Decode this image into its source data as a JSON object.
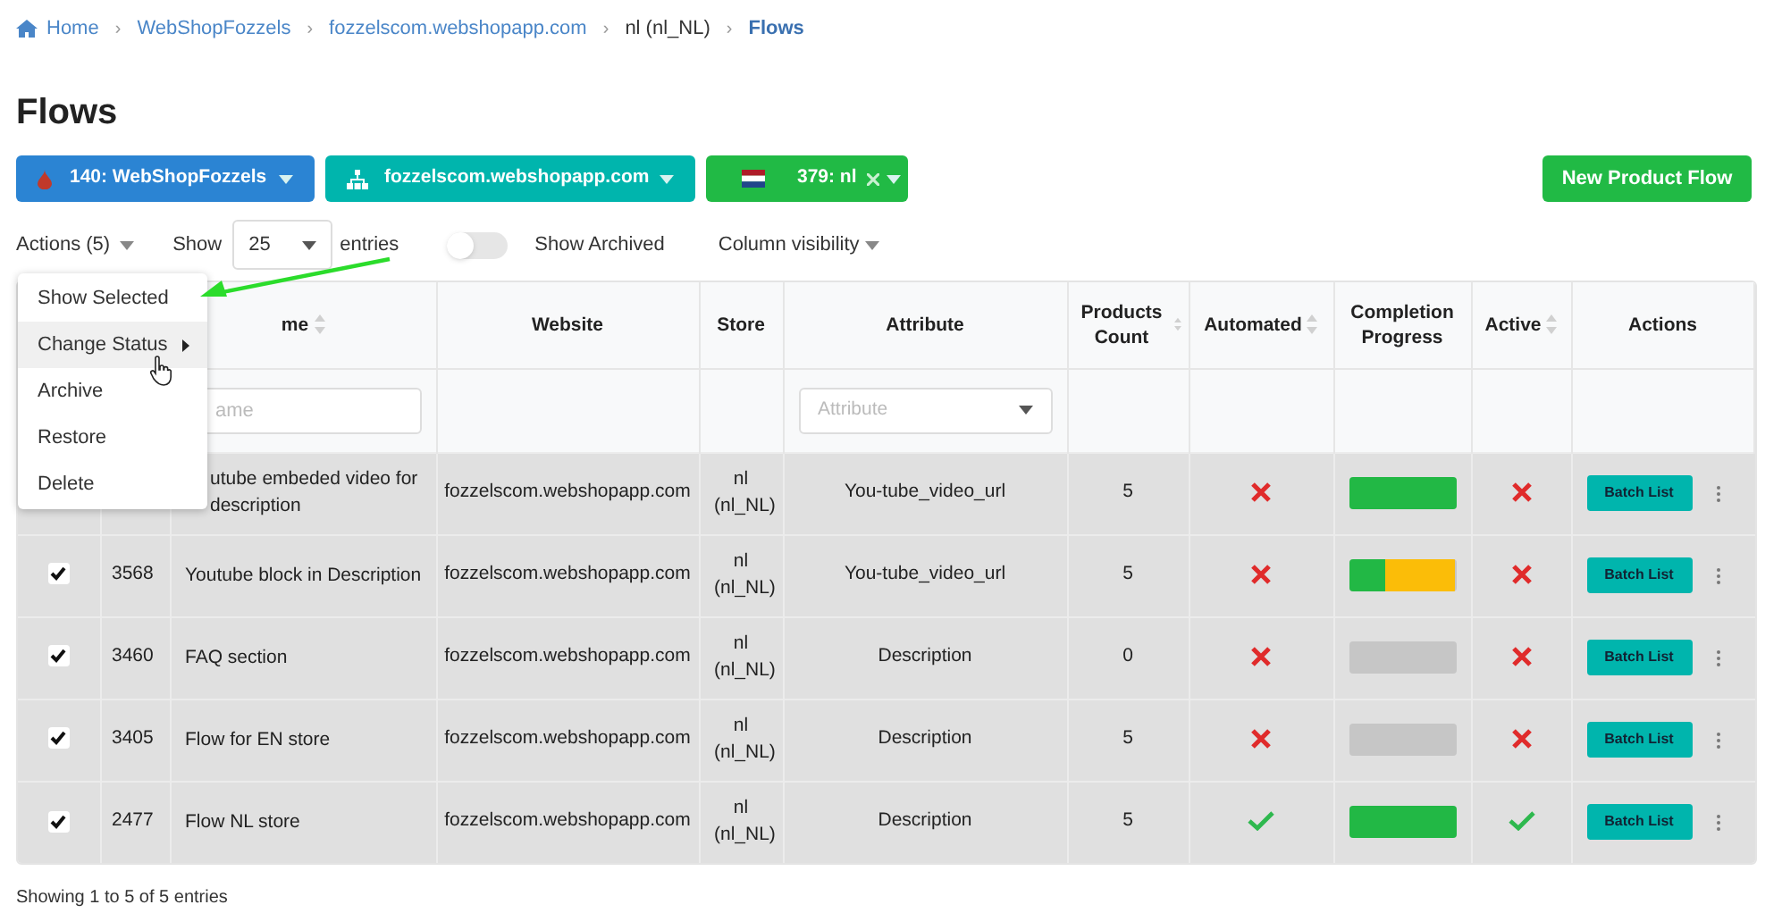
{
  "breadcrumb": [
    {
      "label": "Home",
      "kind": "home"
    },
    {
      "label": "›",
      "kind": "separator"
    },
    {
      "label": "WebShopFozzels",
      "kind": "link"
    },
    {
      "label": "›",
      "kind": "separator"
    },
    {
      "label": "fozzelscom.webshopapp.com",
      "kind": "link"
    },
    {
      "label": "›",
      "kind": "separator"
    },
    {
      "label": "nl (nl_NL)",
      "kind": "text"
    },
    {
      "label": "›",
      "kind": "separator"
    },
    {
      "label": "Flows",
      "kind": "current"
    }
  ],
  "title": "Flows",
  "selectors": [
    {
      "label": "140: WebShopFozzels",
      "color": "#2b84d3",
      "clearable": false
    },
    {
      "label": "fozzelscom.webshopapp.com",
      "color": "#00b5ad",
      "clearable": false
    },
    {
      "label": "379: nl",
      "color": "#21ba45",
      "clearable": true
    }
  ],
  "new_button": "New Product Flow",
  "toolbar": {
    "actions": "Actions (5)",
    "show": "Show",
    "page_size": "25",
    "entries": "entries",
    "archived_toggle": {
      "label": "Show Archived",
      "on": false
    },
    "column_visibility": "Column visibility"
  },
  "actions_menu": [
    {
      "label": "Show Selected",
      "hovered": false
    },
    {
      "label": "Change Status",
      "submenu": true,
      "hovered": true
    },
    {
      "label": "Archive",
      "hovered": false
    },
    {
      "label": "Restore",
      "hovered": false
    },
    {
      "label": "Delete",
      "hovered": false
    }
  ],
  "table": {
    "columns": [
      {
        "label": "me",
        "sortable": true
      },
      {
        "label": "Website",
        "sortable": false
      },
      {
        "label": "Store",
        "sortable": false
      },
      {
        "label": "Attribute",
        "sortable": false
      },
      {
        "label": "Products Count",
        "sortable": true
      },
      {
        "label": "Automated",
        "sortable": true
      },
      {
        "label": "Completion Progress",
        "sortable": false
      },
      {
        "label": "Active",
        "sortable": true
      },
      {
        "label": "Actions",
        "sortable": false
      }
    ],
    "filters": {
      "name": {
        "placeholder": "ame"
      },
      "attribute": {
        "placeholder": "Attribute"
      }
    },
    "rows": [
      {
        "name": "utube embeded video for description",
        "website": "fozzelscom.webshopapp.com",
        "store": "nl (nl_NL)",
        "attribute": "You-tube_video_url",
        "products_count": "5",
        "automated": false,
        "progress": [
          {
            "level": 1,
            "color": "#22b845"
          }
        ],
        "active": false,
        "button": "Batch List"
      },
      {
        "checked": true,
        "id": "3568",
        "name": "Youtube block in Description",
        "website": "fozzelscom.webshopapp.com",
        "store": "nl (nl_NL)",
        "attribute": "You-tube_video_url",
        "products_count": "5",
        "automated": false,
        "progress": [
          {
            "level": 0.34,
            "color": "#22b845"
          },
          {
            "level": 0.66,
            "color": "#fbbd08"
          }
        ],
        "active": false,
        "button": "Batch List"
      },
      {
        "checked": true,
        "id": "3460",
        "name": "FAQ section",
        "website": "fozzelscom.webshopapp.com",
        "store": "nl (nl_NL)",
        "attribute": "Description",
        "products_count": "0",
        "automated": false,
        "progress": [
          {
            "level": 0
          }
        ],
        "active": false,
        "button": "Batch List"
      },
      {
        "checked": true,
        "id": "3405",
        "name": "Flow for EN store",
        "website": "fozzelscom.webshopapp.com",
        "store": "nl (nl_NL)",
        "attribute": "Description",
        "products_count": "5",
        "automated": false,
        "progress": [
          {
            "level": 0
          }
        ],
        "active": false,
        "button": "Batch List"
      },
      {
        "checked": true,
        "id": "2477",
        "name": "Flow NL store",
        "website": "fozzelscom.webshopapp.com",
        "store": "nl (nl_NL)",
        "attribute": "Description",
        "products_count": "5",
        "automated": true,
        "progress": [
          {
            "level": 1,
            "color": "#22b845"
          }
        ],
        "active": true,
        "button": "Batch List"
      }
    ]
  },
  "footer": "Showing 1 to 5 of 5 entries"
}
